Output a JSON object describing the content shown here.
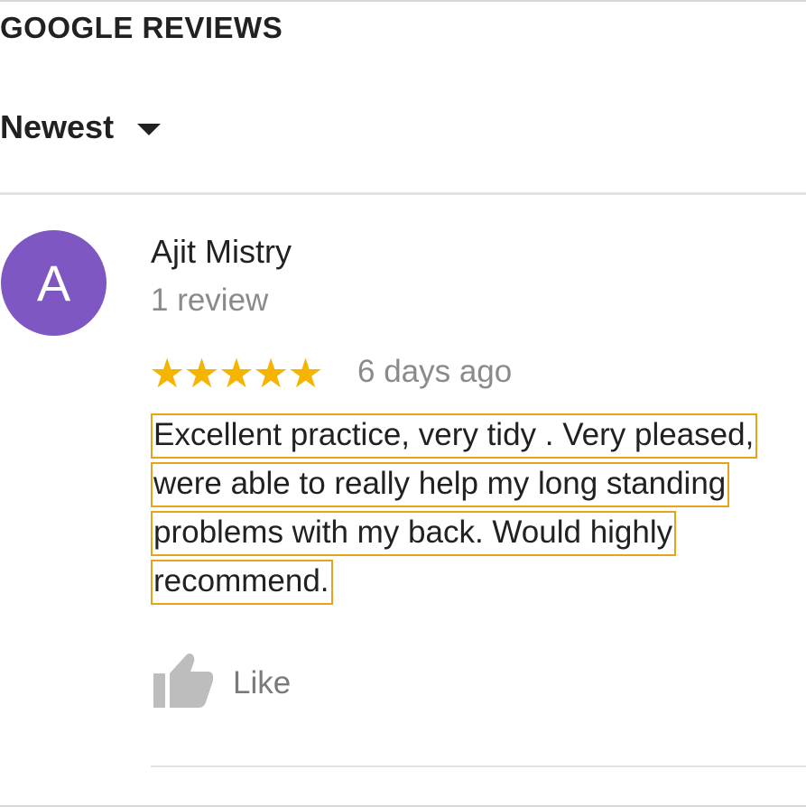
{
  "header": {
    "title": "GOOGLE REVIEWS"
  },
  "sort": {
    "selected": "Newest",
    "icon": "caret-down-icon"
  },
  "review": {
    "avatar_letter": "A",
    "avatar_color": "#7e57c2",
    "reviewer_name": "Ajit Mistry",
    "review_count": "1 review",
    "rating": 5,
    "rating_max": 5,
    "star_color": "#f4b400",
    "date": "6 days ago",
    "text_lines": [
      "Excellent practice, very tidy . Very pleased,",
      "were able to really help my long standing",
      "problems with my back. Would highly",
      "recommend."
    ],
    "highlight_color": "#e8a317"
  },
  "actions": {
    "like_label": "Like",
    "like_icon": "thumbs-up-icon"
  }
}
